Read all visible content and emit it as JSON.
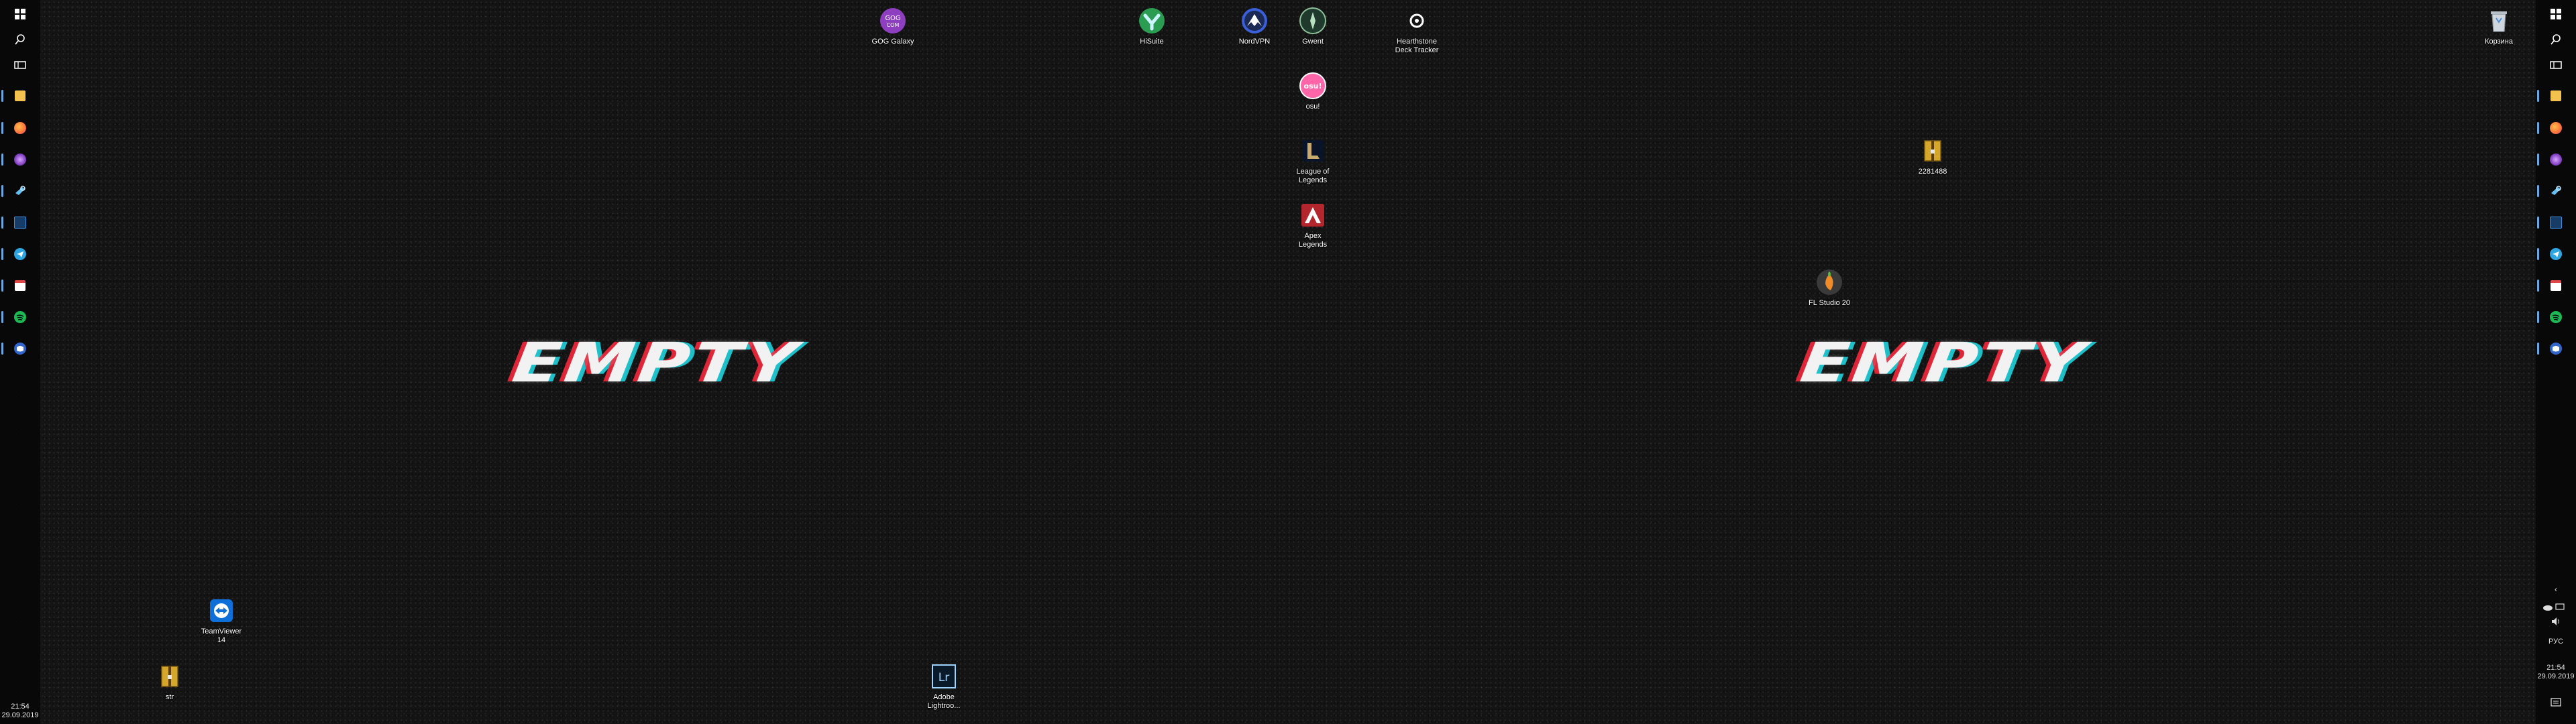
{
  "desktop_icons": [
    {
      "id": "gog",
      "label": "GOG Galaxy",
      "icon": "gog-galaxy-icon",
      "glyph": "GOG",
      "bg": "#8e3fbf"
    },
    {
      "id": "hisuite",
      "label": "HiSuite",
      "icon": "hisuite-icon",
      "glyph": "",
      "bg": "#2a9d52"
    },
    {
      "id": "nordvpn",
      "label": "NordVPN",
      "icon": "nordvpn-icon",
      "glyph": "",
      "bg": "#3a5fd8"
    },
    {
      "id": "gwent",
      "label": "Gwent",
      "icon": "gwent-icon",
      "glyph": "",
      "bg": "#1f3a2c"
    },
    {
      "id": "hdt",
      "label": "Hearthstone\nDeck Tracker",
      "icon": "deck-tracker-icon",
      "glyph": "",
      "bg": "#ffffff"
    },
    {
      "id": "osu",
      "label": "osu!",
      "icon": "osu-icon",
      "glyph": "osu!",
      "bg": "#ff66aa"
    },
    {
      "id": "lol",
      "label": "League of\nLegends",
      "icon": "league-of-legends-icon",
      "glyph": "L",
      "bg": "#c8aa6e"
    },
    {
      "id": "apex",
      "label": "Apex\nLegends",
      "icon": "apex-legends-icon",
      "glyph": "A",
      "bg": "#b3262e"
    },
    {
      "id": "archive",
      "label": "2281488",
      "icon": "archive-icon",
      "glyph": "",
      "bg": "#d4a72c"
    },
    {
      "id": "fl",
      "label": "FL Studio 20",
      "icon": "fl-studio-icon",
      "glyph": "",
      "bg": "#f28c28"
    },
    {
      "id": "teamviewer",
      "label": "TeamViewer\n14",
      "icon": "teamviewer-icon",
      "glyph": "",
      "bg": "#0e6fd8"
    },
    {
      "id": "str",
      "label": "str",
      "icon": "archive-icon",
      "glyph": "",
      "bg": "#d4a72c"
    },
    {
      "id": "lightroom",
      "label": "Adobe\nLightroo...",
      "icon": "lightroom-icon",
      "glyph": "Lr",
      "bg": "#0b1a2b"
    },
    {
      "id": "recycle",
      "label": "Корзина",
      "icon": "recycle-bin-icon",
      "glyph": "",
      "bg": "#cfd6dd"
    }
  ],
  "wallpaper_text": {
    "left": "EMPTY",
    "right": "EMPTY"
  },
  "taskbar_apps": [
    {
      "name": "start-icon",
      "color": "#ffffff"
    },
    {
      "name": "search-icon",
      "color": "#ffffff"
    },
    {
      "name": "task-view-icon",
      "color": "#ffffff"
    },
    {
      "name": "file-explorer-icon",
      "color": "#f2c14e"
    },
    {
      "name": "firefox-icon",
      "color": "#ff7139"
    },
    {
      "name": "tor-browser-icon",
      "color": "#9b4dca"
    },
    {
      "name": "steam-icon",
      "color": "#66c0f4"
    },
    {
      "name": "dota-icon",
      "color": "#3b8edb"
    },
    {
      "name": "telegram-icon",
      "color": "#2ca5e0"
    },
    {
      "name": "calendar-app-icon",
      "color": "#e04848"
    },
    {
      "name": "spotify-icon",
      "color": "#1db954"
    },
    {
      "name": "discord-icon",
      "color": "#5b7bd5"
    }
  ],
  "tray": {
    "lang": "РУС",
    "chevron": "‹"
  },
  "clock": {
    "time": "21:54",
    "date": "29.09.2019"
  }
}
